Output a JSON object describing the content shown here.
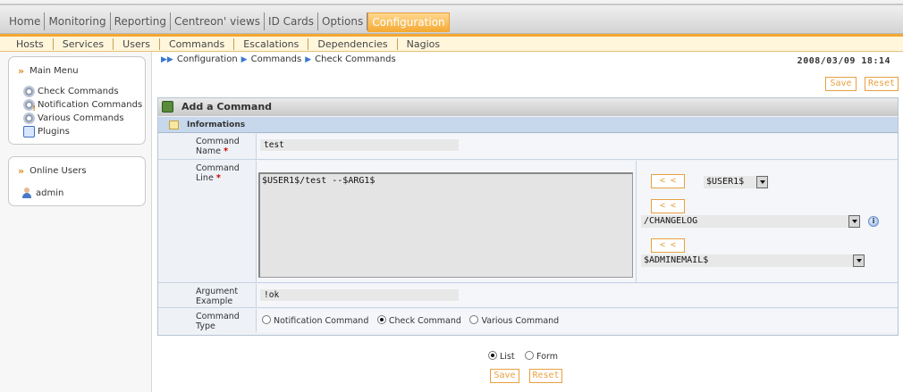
{
  "top_menu": {
    "items": [
      "Home",
      "Monitoring",
      "Reporting",
      "Centreon' views",
      "ID Cards",
      "Options",
      "Configuration"
    ],
    "active": "Configuration"
  },
  "sub_menu": {
    "items": [
      "Hosts",
      "Services",
      "Users",
      "Commands",
      "Escalations",
      "Dependencies",
      "Nagios"
    ]
  },
  "main_menu": {
    "title": "Main Menu",
    "items": [
      {
        "label": "Check Commands",
        "icon": "gear-icon"
      },
      {
        "label": "Notification Commands",
        "icon": "gear-warning-icon"
      },
      {
        "label": "Various Commands",
        "icon": "gear-icon"
      },
      {
        "label": "Plugins",
        "icon": "plugin-icon"
      }
    ]
  },
  "online_users": {
    "title": "Online Users",
    "users": [
      "admin"
    ]
  },
  "breadcrumb": [
    "Configuration",
    "Commands",
    "Check Commands"
  ],
  "datetime": "2008/03/09 18:14",
  "buttons": {
    "save": "Save",
    "reset": "Reset",
    "insert": "< <"
  },
  "form": {
    "title": "Add a Command",
    "section": "Informations",
    "command_name": {
      "label_line1": "Command",
      "label_line2": "Name",
      "value": "test"
    },
    "command_line": {
      "label_line1": "Command",
      "label_line2": "Line",
      "value": "$USER1$/test --$ARG1$",
      "macro_select": "$USER1$",
      "plugin_select": "/CHANGELOG",
      "macro2_select": "$ADMINEMAIL$"
    },
    "argument_example": {
      "label_line1": "Argument",
      "label_line2": "Example",
      "value": "!ok"
    },
    "command_type": {
      "label_line1": "Command",
      "label_line2": "Type",
      "options": [
        "Notification Command",
        "Check Command",
        "Various Command"
      ],
      "selected": "Check Command"
    }
  },
  "view_mode": {
    "options": [
      "List",
      "Form"
    ],
    "selected": "List"
  }
}
